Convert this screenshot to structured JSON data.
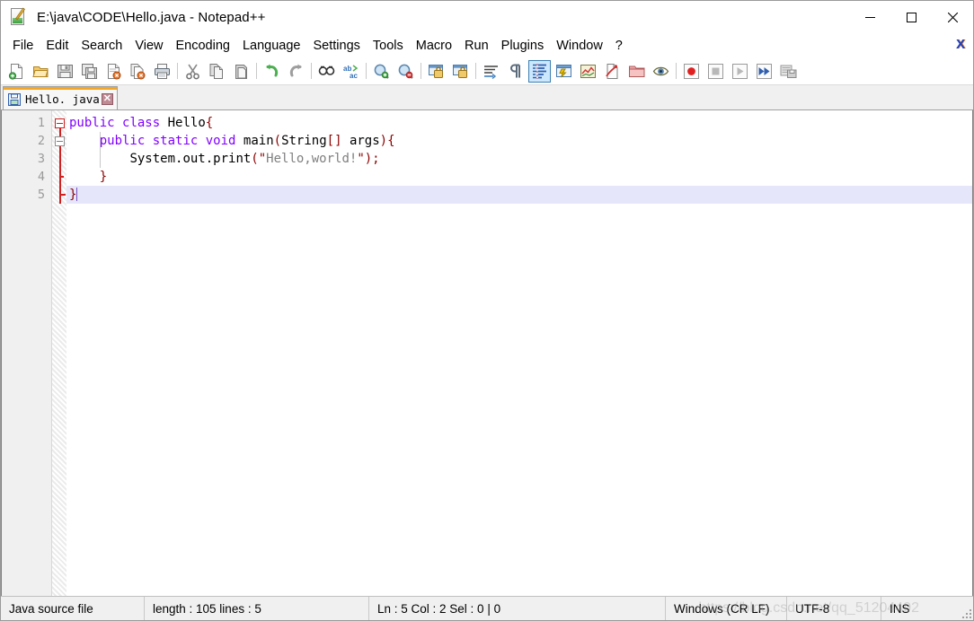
{
  "window": {
    "title": "E:\\java\\CODE\\Hello.java - Notepad++",
    "app_icon": "notepad-plus-plus-icon",
    "controls": {
      "minimize": "minimize-icon",
      "maximize": "maximize-icon",
      "close": "close-icon"
    }
  },
  "menubar": {
    "items": [
      {
        "label": "File"
      },
      {
        "label": "Edit"
      },
      {
        "label": "Search"
      },
      {
        "label": "View"
      },
      {
        "label": "Encoding"
      },
      {
        "label": "Language"
      },
      {
        "label": "Settings"
      },
      {
        "label": "Tools"
      },
      {
        "label": "Macro"
      },
      {
        "label": "Run"
      },
      {
        "label": "Plugins"
      },
      {
        "label": "Window"
      },
      {
        "label": "?"
      }
    ],
    "close_document_label": "X"
  },
  "toolbar": {
    "buttons": [
      {
        "name": "new-file",
        "active": false
      },
      {
        "name": "open-file",
        "active": false
      },
      {
        "name": "save",
        "active": false
      },
      {
        "name": "save-all",
        "active": false
      },
      {
        "name": "close-document",
        "active": false
      },
      {
        "name": "close-all-documents",
        "active": false
      },
      {
        "name": "print",
        "active": false
      },
      {
        "name": "cut",
        "active": false
      },
      {
        "name": "copy",
        "active": false
      },
      {
        "name": "paste",
        "active": false
      },
      {
        "name": "undo",
        "active": false
      },
      {
        "name": "redo",
        "active": false
      },
      {
        "name": "find",
        "active": false
      },
      {
        "name": "replace",
        "active": false
      },
      {
        "name": "zoom-in",
        "active": false
      },
      {
        "name": "zoom-out",
        "active": false
      },
      {
        "name": "sync-vertical-scroll",
        "active": false
      },
      {
        "name": "sync-horizontal-scroll",
        "active": false
      },
      {
        "name": "word-wrap",
        "active": false
      },
      {
        "name": "show-all-characters",
        "active": false
      },
      {
        "name": "indent-guide",
        "active": true
      },
      {
        "name": "user-defined-dialog",
        "active": false
      },
      {
        "name": "document-map",
        "active": false
      },
      {
        "name": "function-list",
        "active": false
      },
      {
        "name": "folder-as-workspace",
        "active": false
      },
      {
        "name": "document-monitoring",
        "active": false
      },
      {
        "name": "record-macro",
        "active": false
      },
      {
        "name": "stop-recording-macro",
        "active": false
      },
      {
        "name": "play-macro",
        "active": false
      },
      {
        "name": "run-macro-multiple",
        "active": false
      },
      {
        "name": "save-current-macro",
        "active": false
      }
    ]
  },
  "tabs": [
    {
      "label": "Hello. java",
      "save_icon": "saved-floppy-icon",
      "close_label": "✕",
      "active": true
    }
  ],
  "editor": {
    "lines": [
      {
        "number": "1",
        "current": false,
        "fold": "open-red",
        "tokens": [
          {
            "text": "public",
            "type": "kw"
          },
          {
            "text": " ",
            "type": "plain"
          },
          {
            "text": "class",
            "type": "kw"
          },
          {
            "text": " ",
            "type": "plain"
          },
          {
            "text": "Hello",
            "type": "plain"
          },
          {
            "text": "{",
            "type": "op"
          }
        ]
      },
      {
        "number": "2",
        "current": false,
        "fold": "open-gray",
        "tokens": [
          {
            "text": "    ",
            "type": "plain"
          },
          {
            "text": "public",
            "type": "kw"
          },
          {
            "text": " ",
            "type": "plain"
          },
          {
            "text": "static",
            "type": "kw"
          },
          {
            "text": " ",
            "type": "plain"
          },
          {
            "text": "void",
            "type": "kw"
          },
          {
            "text": " ",
            "type": "plain"
          },
          {
            "text": "main",
            "type": "plain"
          },
          {
            "text": "(",
            "type": "op"
          },
          {
            "text": "String",
            "type": "plain"
          },
          {
            "text": "[]",
            "type": "op"
          },
          {
            "text": " ",
            "type": "plain"
          },
          {
            "text": "args",
            "type": "plain"
          },
          {
            "text": "){",
            "type": "op"
          }
        ]
      },
      {
        "number": "3",
        "current": false,
        "fold": "line",
        "tokens": [
          {
            "text": "        ",
            "type": "plain"
          },
          {
            "text": "System.out.print",
            "type": "plain"
          },
          {
            "text": "(\"",
            "type": "op"
          },
          {
            "text": "Hello,world!",
            "type": "str"
          },
          {
            "text": "\");",
            "type": "op"
          }
        ]
      },
      {
        "number": "4",
        "current": false,
        "fold": "tick",
        "tokens": [
          {
            "text": "    ",
            "type": "plain"
          },
          {
            "text": "}",
            "type": "op"
          }
        ]
      },
      {
        "number": "5",
        "current": true,
        "fold": "end",
        "tokens": [
          {
            "text": "}",
            "type": "op"
          }
        ]
      }
    ]
  },
  "statusbar": {
    "file_type": "Java source file",
    "length_lines": "length : 105    lines : 5",
    "position": "Ln : 5    Col : 2    Sel : 0 | 0",
    "eol": "Windows (CR LF)",
    "encoding": "UTF-8",
    "insert_mode": "INS",
    "watermark": "https://blog.csdn.net/qq_51204492"
  },
  "colors": {
    "keyword": "#8000ff",
    "operator": "#8b0000",
    "string": "#808080",
    "plain": "#000000",
    "current_line": "#e6e6fa",
    "tab_accent": "#f5a623",
    "toolbar_active": "#cce8ff",
    "gutter_bg": "#f0f0f0",
    "linenumber": "#9a9a9a"
  }
}
